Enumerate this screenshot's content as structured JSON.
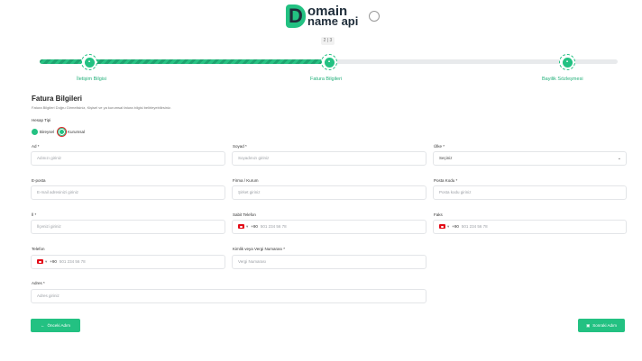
{
  "brand": {
    "logo_line1": "omain",
    "logo_line2": "name api",
    "logo_letter": "D",
    "partner_label": "ICANN"
  },
  "progress": {
    "step_text": "2 | 3",
    "fill_fraction": 0.5
  },
  "steps": [
    {
      "label": "İletişim Bilgisi"
    },
    {
      "label": "Fatura Bilgileri"
    },
    {
      "label": "Bayilik Sözleşmesi"
    }
  ],
  "form": {
    "title": "Fatura Bilgileri",
    "subtitle": "Fatura Bilgileri Doğru Girmelisiniz, Kişisel ve ya kurumsal fatura bilgisi belirleyebilirsiniz.",
    "account_type_label": "Hesap Tipi",
    "account_types": [
      "Bireysel",
      "Kurumsal"
    ],
    "selected_account_type": "Kurumsal",
    "fields": {
      "ad": {
        "label": "Ad *",
        "placeholder": "Adınızı giriniz"
      },
      "soyad": {
        "label": "Soyad *",
        "placeholder": "Soyadınızı giriniz"
      },
      "ulke": {
        "label": "Ülke *",
        "value": "Seçiniz"
      },
      "eposta": {
        "label": "E-posta",
        "placeholder": "E-mail adresinizi giriniz"
      },
      "firma": {
        "label": "Firma / Kurum",
        "placeholder": "Şirket giriniz"
      },
      "posta": {
        "label": "Posta Kodu *",
        "placeholder": "Posta kodu giriniz"
      },
      "il": {
        "label": "İl *",
        "placeholder": "İlçenizi giriniz"
      },
      "sabit_tel": {
        "label": "Sabit Telefon",
        "code": "+90",
        "placeholder": "501 234 56 78"
      },
      "faks": {
        "label": "Faks",
        "code": "+90",
        "placeholder": "501 234 56 78"
      },
      "telefon": {
        "label": "Telefon",
        "code": "+90",
        "placeholder": "501 234 56 78"
      },
      "vergi": {
        "label": "Kimlik veya Vergi Numarası *",
        "placeholder": "Vergi Numarası"
      },
      "adres": {
        "label": "Adres *",
        "placeholder": "Adres giriniz"
      }
    }
  },
  "buttons": {
    "back": "Önceki Adım",
    "next": "Sonraki Adım"
  },
  "colors": {
    "accent": "#23c182",
    "highlight_ring": "#e0262a"
  }
}
